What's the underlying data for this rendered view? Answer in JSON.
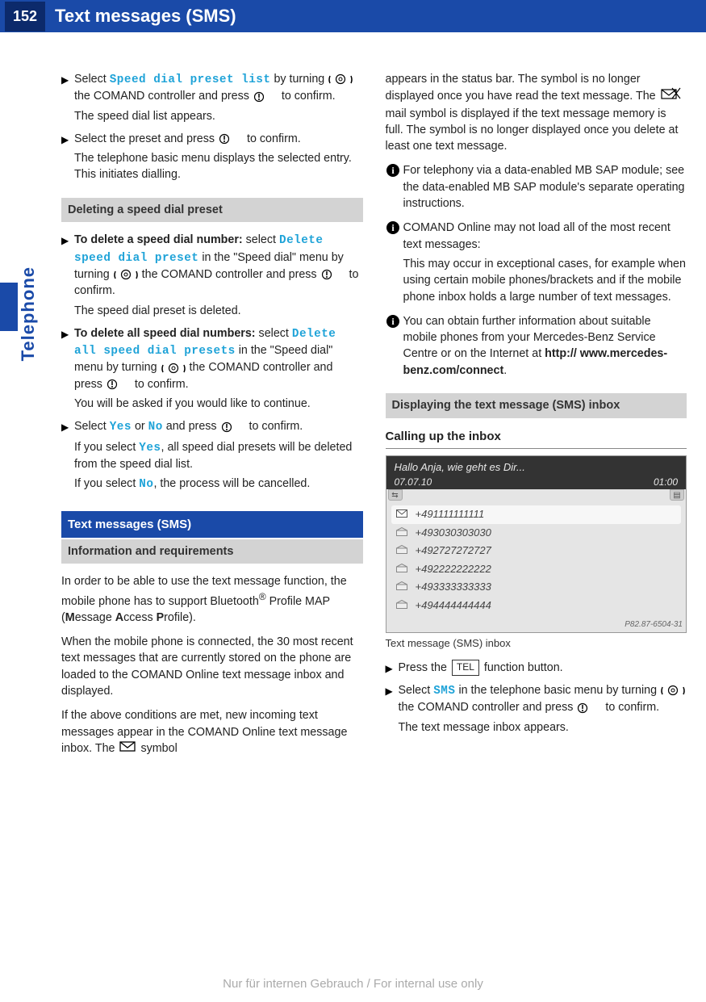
{
  "header": {
    "page_number": "152",
    "title": "Text messages (SMS)"
  },
  "sidebar": {
    "section": "Telephone"
  },
  "left": {
    "step1": {
      "pre": "Select ",
      "menu": "Speed dial preset list",
      "post": " by turning ",
      "post2": " the COMAND controller and press ",
      "post3": " to confirm.",
      "result": "The speed dial list appears."
    },
    "step2": {
      "text_a": "Select the preset and press ",
      "text_b": " to confirm.",
      "result": "The telephone basic menu displays the selected entry. This initiates dialling."
    },
    "h_delete": "Deleting a speed dial preset",
    "step3": {
      "bold": "To delete a speed dial number:",
      "text_a": " select ",
      "menu": "Delete speed dial preset",
      "text_b": " in the \"Speed dial\" menu by turning ",
      "text_c": " the COMAND controller and press ",
      "text_d": " to confirm.",
      "result": "The speed dial preset is deleted."
    },
    "step4": {
      "bold": "To delete all speed dial numbers:",
      "text_a": " select ",
      "menu": "Delete all speed dial presets",
      "text_b": " in the \"Speed dial\" menu by turning ",
      "text_c": " the COMAND controller and press ",
      "text_d": " to confirm.",
      "result": "You will be asked if you would like to continue."
    },
    "step5": {
      "pre": "Select ",
      "yes": "Yes",
      "mid": " or ",
      "no": "No",
      "post_a": " and press ",
      "post_b": " to confirm.",
      "r1_a": "If you select ",
      "r1_b": ", all speed dial presets will be deleted from the speed dial list.",
      "r2_a": "If you select ",
      "r2_b": ", the process will be cancelled."
    },
    "h_sms": "Text messages (SMS)",
    "h_info": "Information and requirements",
    "p1_a": "In order to be able to use the text message function, the mobile phone has to support Bluetooth",
    "p1_b": " Profile MAP (",
    "p1_m": "M",
    "p1_c": "essage ",
    "p1_ac": "A",
    "p1_d": "ccess ",
    "p1_p": "P",
    "p1_e": "rofile).",
    "p2": "When the mobile phone is connected, the 30 most recent text messages that are currently stored on the phone are loaded to the COMAND Online text message inbox and displayed.",
    "p3_a": "If the above conditions are met, new incoming text messages appear in the COMAND Online text message inbox. The ",
    "p3_b": " symbol"
  },
  "right": {
    "p1_a": "appears in the status bar. The symbol is no longer displayed once you have read the text message. The ",
    "p1_b": " mail symbol is displayed if the text message memory is full. The symbol is no longer displayed once you delete at least one text message.",
    "info1": "For telephony via a data-enabled MB SAP module; see the data-enabled MB SAP module's separate operating instructions.",
    "info2_a": "COMAND Online may not load all of the most recent text messages:",
    "info2_b": "This may occur in exceptional cases, for example when using certain mobile phones/brackets and if the mobile phone inbox holds a large number of text messages.",
    "info3_a": "You can obtain further information about suitable mobile phones from your Mercedes-Benz Service Centre or on the Internet at ",
    "info3_b": "http:// www.mercedes-benz.com/connect",
    "info3_c": ".",
    "h_inbox": "Displaying the text message (SMS) inbox",
    "sub_calling": "Calling up the inbox",
    "screenshot": {
      "title": "Hallo Anja, wie geht es Dir...",
      "date": "07.07.10",
      "time": "01:00",
      "rows": [
        "+491111111111",
        "+493030303030",
        "+492727272727",
        "+492222222222",
        "+493333333333",
        "+494444444444"
      ],
      "img_id": "P82.87-6504-31"
    },
    "caption": "Text message (SMS) inbox",
    "step_tel_a": "Press the ",
    "step_tel_btn": "TEL",
    "step_tel_b": " function button.",
    "step_sms_a": "Select ",
    "step_sms_menu": "SMS",
    "step_sms_b": " in the telephone basic menu by turning ",
    "step_sms_c": " the COMAND controller and press ",
    "step_sms_d": " to confirm.",
    "step_sms_result": "The text message inbox appears."
  },
  "footer": "Nur für internen Gebrauch / For internal use only"
}
